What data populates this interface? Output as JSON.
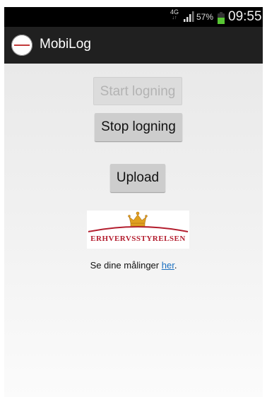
{
  "status_bar": {
    "network": "4G",
    "battery": "57%",
    "battery_level": 0.57,
    "time": "09:55"
  },
  "action_bar": {
    "title": "MobiLog",
    "logo_icon": "mobilog-logo-icon"
  },
  "buttons": {
    "start_label": "Start logning",
    "start_enabled": false,
    "stop_label": "Stop logning",
    "upload_label": "Upload"
  },
  "agency_logo": {
    "text": "ERHVERVSSTYRELSEN",
    "icon": "crown-icon",
    "color": "#b31d2e"
  },
  "info": {
    "prefix": "Se dine målinger ",
    "link": "her",
    "suffix": "."
  },
  "colors": {
    "link": "#1a6fc0",
    "action_bar": "#202020",
    "battery": "#58c634"
  }
}
